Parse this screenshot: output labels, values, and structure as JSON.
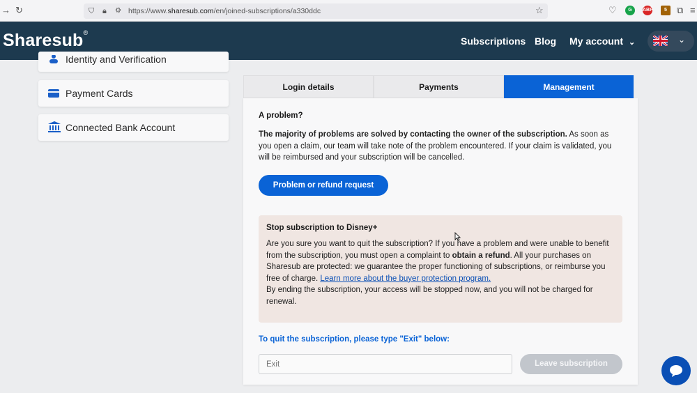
{
  "browser": {
    "url_prefix": "https://www.",
    "url_domain": "sharesub.com",
    "url_path": "/en/joined-subscriptions/a330ddc"
  },
  "header": {
    "logo": "Sharesub",
    "logo_mark": "®",
    "nav": {
      "subscriptions": "Subscriptions",
      "blog": "Blog",
      "my_account": "My account"
    },
    "language": "English"
  },
  "sidebar": {
    "items": [
      {
        "label": "Identity and Verification",
        "icon": "user-icon"
      },
      {
        "label": "Payment Cards",
        "icon": "card-icon"
      },
      {
        "label": "Connected Bank Account",
        "icon": "bank-icon"
      }
    ]
  },
  "tabs": [
    {
      "label": "Login details",
      "active": false
    },
    {
      "label": "Payments",
      "active": false
    },
    {
      "label": "Management",
      "active": true
    }
  ],
  "problem": {
    "title": "A problem?",
    "bold_text": "The majority of problems are solved by contacting the owner of the subscription.",
    "text": " As soon as you open a claim, our team will take note of the problem encountered. If your claim is validated, you will be reimbursed and your subscription will be cancelled.",
    "button": "Problem or refund request"
  },
  "stop": {
    "title": "Stop subscription to Disney+",
    "text_1": "Are you sure you want to quit the subscription? If you have a problem and were unable to benefit from the subscription, you must open a complaint to ",
    "text_bold": "obtain a refund",
    "text_2": ". All your purchases on Sharesub are protected: we guarantee the proper functioning of subscriptions, or reimburse you free of charge. ",
    "link": "Learn more about the buyer protection program.",
    "text_3": "By ending the subscription, your access will be stopped now, and you will not be charged for renewal."
  },
  "quit": {
    "label": "To quit the subscription, please type \"Exit\" below:",
    "placeholder": "Exit",
    "button": "Leave subscription"
  },
  "colors": {
    "header_bg": "#1d3a4f",
    "accent": "#0a63d6",
    "warning_bg": "#f0e6e2",
    "disabled_button": "#c2c6cc"
  }
}
